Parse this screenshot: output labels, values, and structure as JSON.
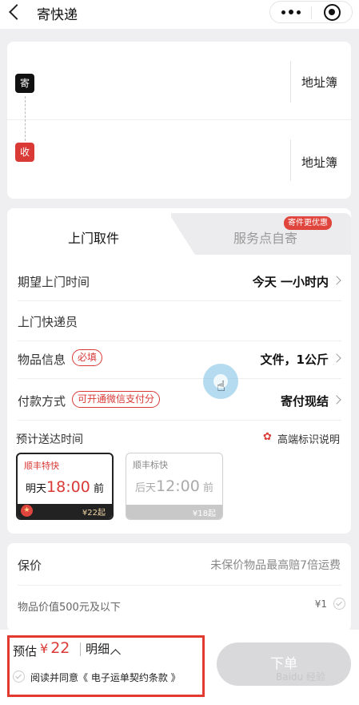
{
  "header": {
    "title": "寄快递",
    "back_icon": "chevron-left-icon",
    "more_icon": "more-dots-icon",
    "close_icon": "target-icon"
  },
  "address": {
    "sender": {
      "badge": "寄",
      "book_label": "地址簿"
    },
    "receiver": {
      "badge": "收",
      "book_label": "地址簿"
    }
  },
  "service": {
    "tabs": [
      {
        "label": "上门取件",
        "active": true
      },
      {
        "label": "服务点自寄",
        "active": false,
        "promo": "寄件更优惠"
      }
    ],
    "rows": {
      "pickup_time": {
        "label": "期望上门时间",
        "value": "今天 一小时内"
      },
      "courier": {
        "label": "上门快递员"
      },
      "item": {
        "label": "物品信息",
        "tag": "必填",
        "value": "文件，1公斤"
      },
      "payment": {
        "label": "付款方式",
        "tag": "可开通微信支付分",
        "value": "寄付现结"
      }
    },
    "eta": {
      "title": "预计送达时间",
      "legend": "高端标识说明",
      "options": [
        {
          "name": "顺丰特快",
          "day": "明天",
          "time": "18:00",
          "suffix": "前",
          "price": "¥22起",
          "selected": true
        },
        {
          "name": "顺丰标快",
          "day": "后天",
          "time": "12:00",
          "suffix": "前",
          "price": "¥18起",
          "selected": false
        }
      ]
    }
  },
  "insurance": {
    "title": "保价",
    "note": "未保价物品最高赔7倍运费",
    "item_label": "物品价值500元及以下",
    "item_price": "¥1"
  },
  "footer": {
    "estimate_label": "预估",
    "currency": "¥",
    "amount": "22",
    "detail_label": "明细",
    "agreement": "阅读并同意《 电子运单契约条款 》",
    "submit_label": "下单",
    "watermark": "Baidu 经验"
  },
  "colors": {
    "accent_red": "#d93a36",
    "background": "#efeff1",
    "submit_disabled": "#d9d9db"
  }
}
